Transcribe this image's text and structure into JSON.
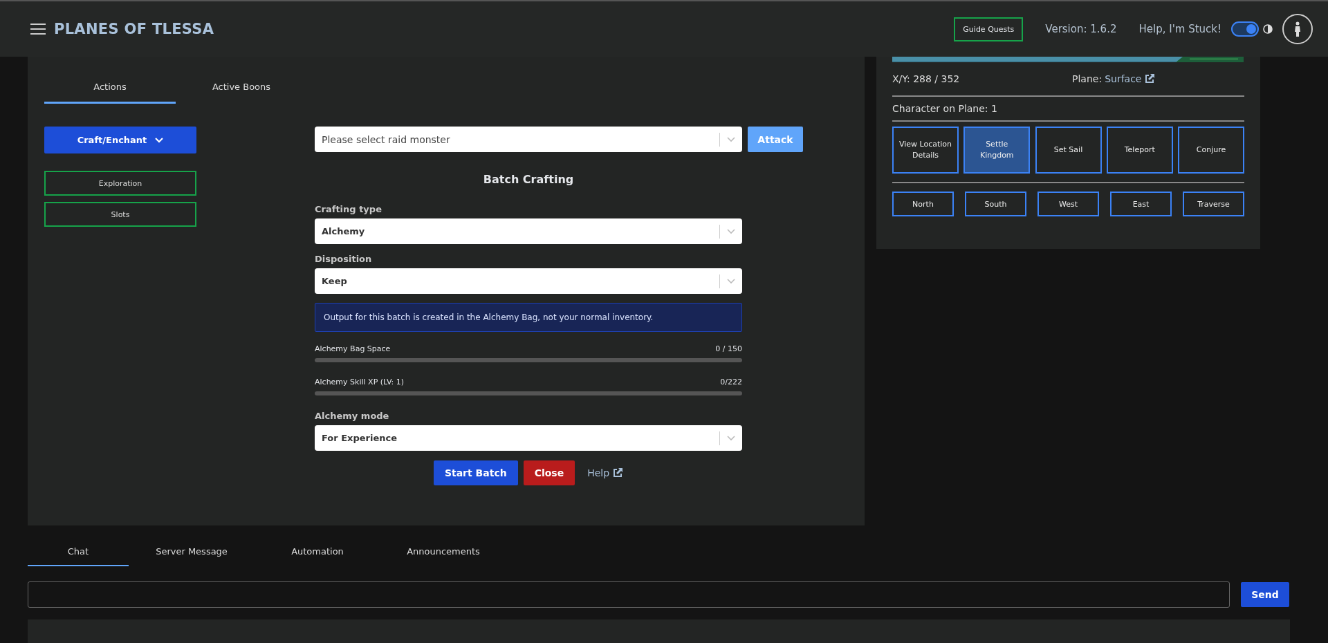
{
  "header": {
    "title": "PLANES OF TLESSA",
    "guide_button": "Guide Quests",
    "version": "Version: 1.6.2",
    "help_link": "Help, I'm Stuck!",
    "theme_toggle": {
      "on": true
    }
  },
  "action_tabs": [
    {
      "label": "Actions",
      "selected": true
    },
    {
      "label": "Active Boons",
      "selected": false
    }
  ],
  "action_menu": {
    "dropdown": "Craft/Enchant",
    "buttons": [
      "Exploration",
      "Slots"
    ]
  },
  "raid": {
    "placeholder": "Please select raid monster",
    "button": "Attack"
  },
  "batch_crafting": {
    "title": "Batch Crafting",
    "fields": [
      {
        "label": "Crafting type",
        "value": "Alchemy"
      },
      {
        "label": "Disposition",
        "value": "Keep"
      }
    ],
    "notice": "Output for this batch is created in the Alchemy Bag, not your normal inventory.",
    "meters": [
      {
        "label": "Alchemy Bag Space",
        "reading": "0 / 150",
        "level": 0
      },
      {
        "label": "Alchemy Skill XP (LV: 1)",
        "reading": "0/222",
        "level": 0
      }
    ],
    "mode_field": {
      "label": "Alchemy mode",
      "value": "For Experience"
    },
    "buttons": [
      {
        "label": "Start Batch",
        "kind": "primary"
      },
      {
        "label": "Close",
        "kind": "danger"
      }
    ],
    "help_link": "Help"
  },
  "map_panel": {
    "coords": "X/Y: 288 / 352",
    "plane_label": "Plane:",
    "plane_link": "Surface",
    "characters": "Character on Plane: 1",
    "actions": [
      {
        "label": "View Location Details",
        "selected": false
      },
      {
        "label": "Settle Kingdom",
        "selected": true
      },
      {
        "label": "Set Sail",
        "selected": false
      },
      {
        "label": "Teleport",
        "selected": false
      },
      {
        "label": "Conjure",
        "selected": false
      }
    ],
    "moves": [
      "North",
      "South",
      "West",
      "East",
      "Traverse"
    ]
  },
  "chat": {
    "tabs": [
      {
        "label": "Chat",
        "selected": true
      },
      {
        "label": "Server Message",
        "selected": false
      },
      {
        "label": "Automation",
        "selected": false
      },
      {
        "label": "Announcements",
        "selected": false
      }
    ],
    "send": "Send"
  }
}
